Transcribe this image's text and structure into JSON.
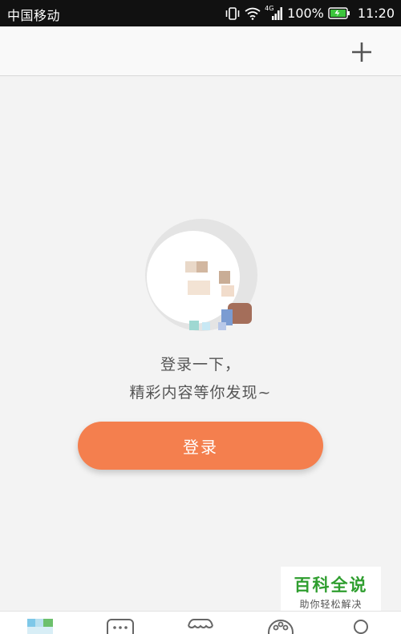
{
  "status_bar": {
    "carrier": "中国移动",
    "network": "4G",
    "battery_percent": "100%",
    "time": "11:20"
  },
  "top_bar": {
    "add_icon": "plus-icon"
  },
  "main": {
    "prompt_line1": "登录一下，",
    "prompt_line2": "精彩内容等你发现~",
    "login_button_label": "登录"
  },
  "watermark": {
    "title": "百科全说",
    "subtitle": "助你轻松解决"
  },
  "bottom_nav": {
    "items": [
      {
        "icon": "home-icon"
      },
      {
        "icon": "chat-icon"
      },
      {
        "icon": "shop-icon"
      },
      {
        "icon": "discover-icon"
      },
      {
        "icon": "profile-icon"
      }
    ]
  },
  "colors": {
    "accent": "#f47f4e",
    "watermark_green": "#2f9e2f"
  }
}
